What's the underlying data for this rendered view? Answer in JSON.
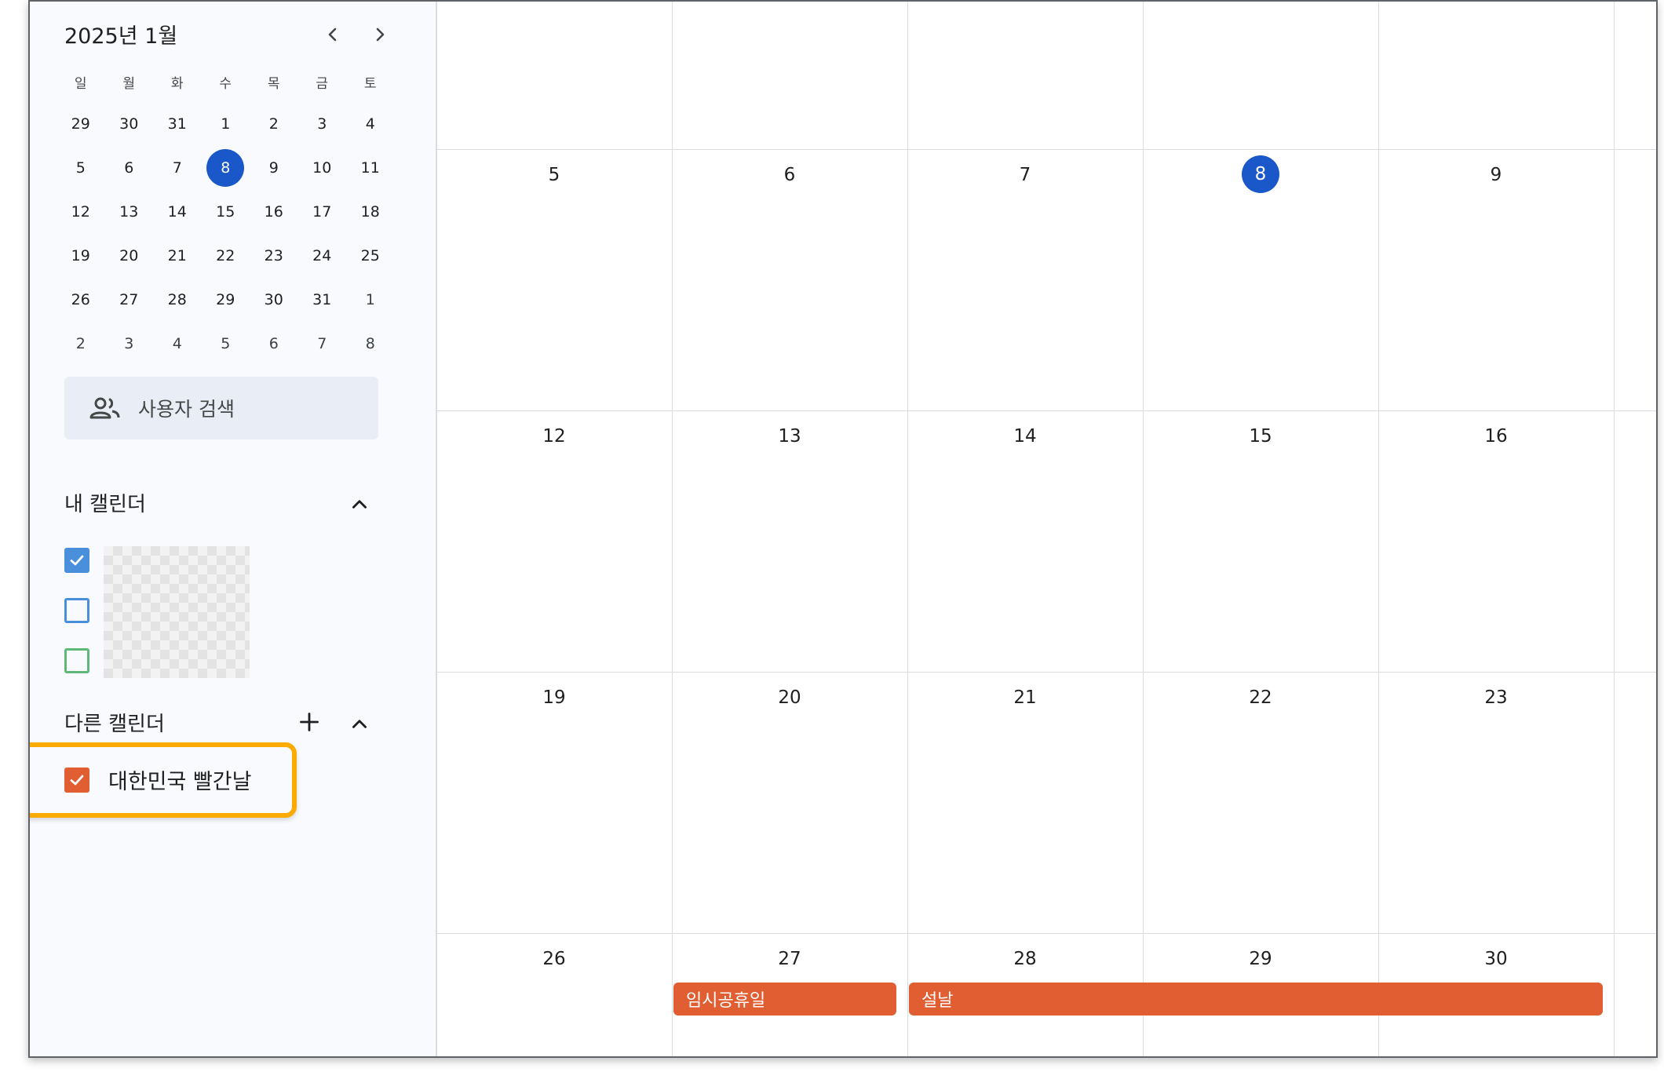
{
  "mini_calendar": {
    "title": "2025년 1월",
    "weekdays": [
      "일",
      "월",
      "화",
      "수",
      "목",
      "금",
      "토"
    ],
    "weeks": [
      [
        "29",
        "30",
        "31",
        "1",
        "2",
        "3",
        "4"
      ],
      [
        "5",
        "6",
        "7",
        "8",
        "9",
        "10",
        "11"
      ],
      [
        "12",
        "13",
        "14",
        "15",
        "16",
        "17",
        "18"
      ],
      [
        "19",
        "20",
        "21",
        "22",
        "23",
        "24",
        "25"
      ],
      [
        "26",
        "27",
        "28",
        "29",
        "30",
        "31",
        "1"
      ],
      [
        "2",
        "3",
        "4",
        "5",
        "6",
        "7",
        "8"
      ]
    ],
    "today": "8"
  },
  "people_search": {
    "label": "사용자 검색"
  },
  "my_calendars": {
    "title": "내 캘린더"
  },
  "other_calendars": {
    "title": "다른 캘린더",
    "items": [
      {
        "label": "대한민국 빨간날",
        "color": "#e15d32"
      }
    ]
  },
  "month_grid": {
    "rows": [
      [
        "",
        "",
        "",
        "",
        ""
      ],
      [
        "5",
        "6",
        "7",
        "8",
        "9"
      ],
      [
        "12",
        "13",
        "14",
        "15",
        "16"
      ],
      [
        "19",
        "20",
        "21",
        "22",
        "23"
      ],
      [
        "26",
        "27",
        "28",
        "29",
        "30"
      ]
    ],
    "today": "8",
    "events": [
      {
        "title": "임시공휴일",
        "color": "#e15d32"
      },
      {
        "title": "설날",
        "color": "#e15d32"
      }
    ]
  },
  "colors": {
    "accent": "#1a57c9",
    "holiday": "#e15d32",
    "highlight": "#fbab00"
  }
}
